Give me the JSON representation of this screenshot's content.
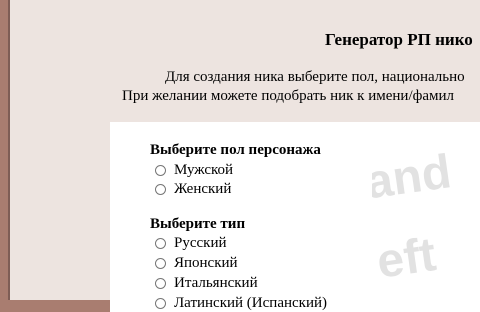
{
  "page": {
    "title": "Генератор РП нико",
    "intro_line1": "Для создания ника выберите пол, национально",
    "intro_line2": "При желании можете подобрать ник к имени/фамил"
  },
  "form": {
    "gender": {
      "heading": "Выберите пол персонажа",
      "options": [
        {
          "label": "Мужской",
          "checked": false
        },
        {
          "label": "Женский",
          "checked": false
        }
      ]
    },
    "type": {
      "heading": "Выберите тип",
      "options": [
        {
          "label": "Русский",
          "checked": false
        },
        {
          "label": "Японский",
          "checked": false
        },
        {
          "label": "Итальянский",
          "checked": false
        },
        {
          "label": "Латинский (Испанский)",
          "checked": false
        }
      ]
    }
  },
  "colors": {
    "outer_background": "#a97d70",
    "page_background": "#ede4e0",
    "panel_background": "#ffffff"
  }
}
